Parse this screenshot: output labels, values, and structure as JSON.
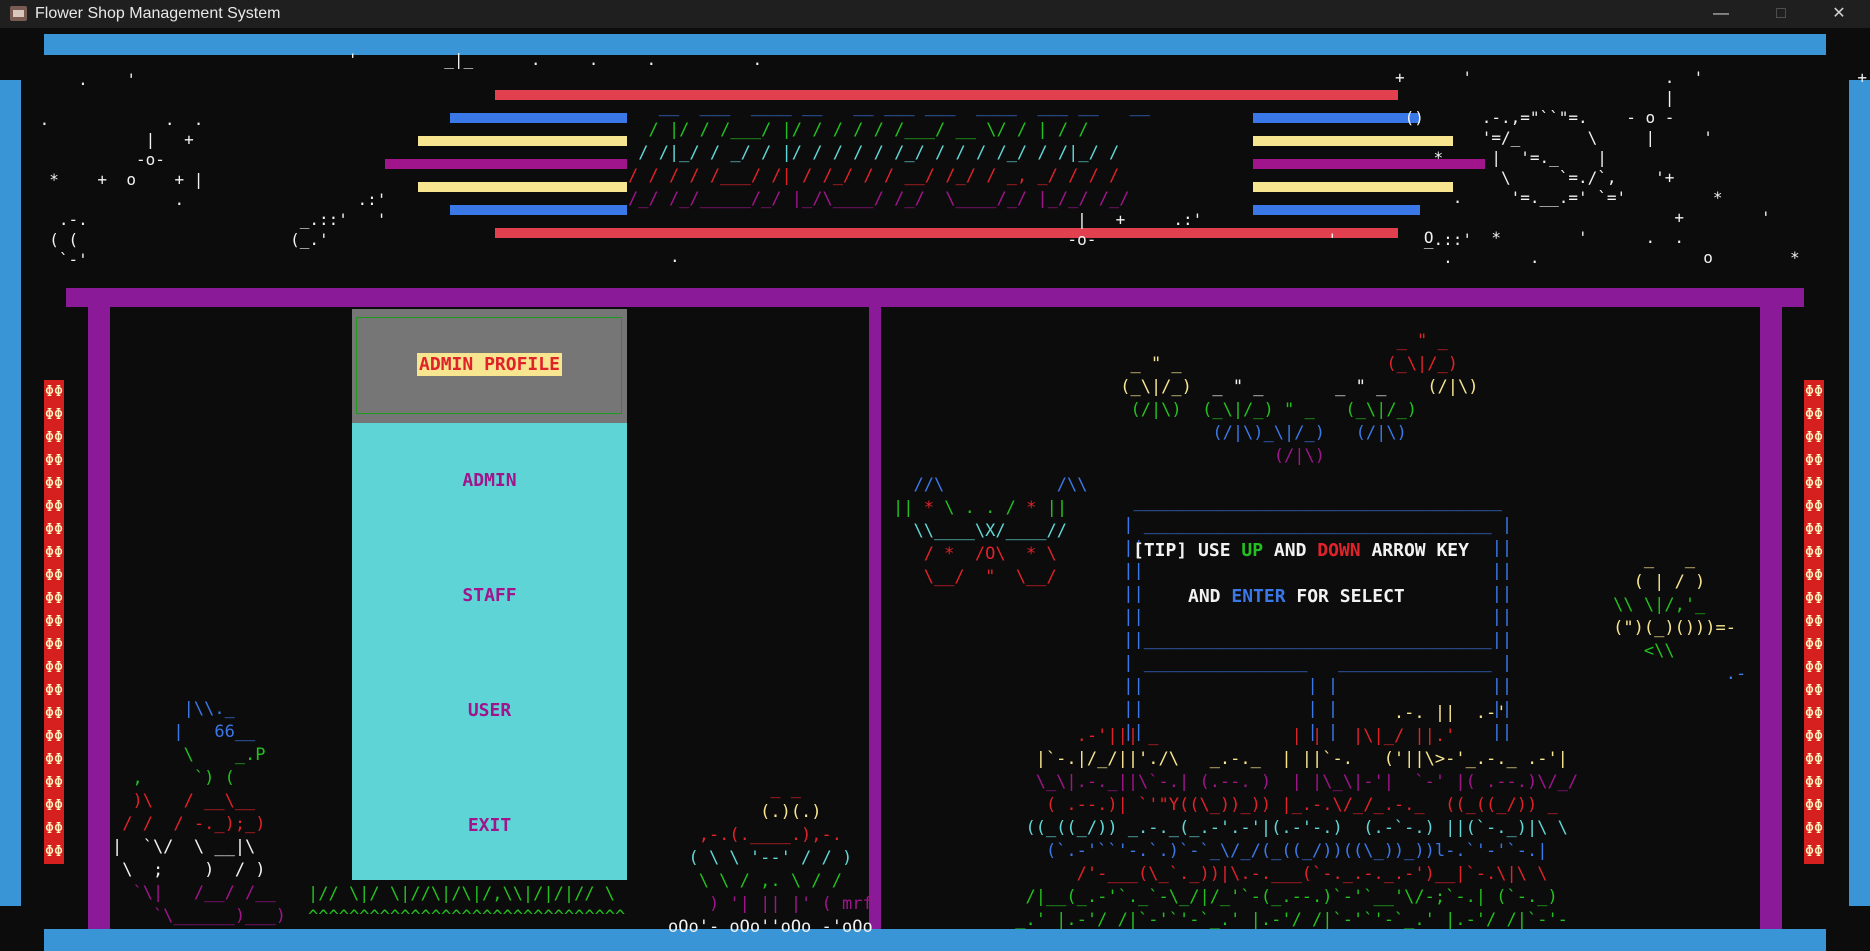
{
  "window": {
    "title": "Flower Shop Management System",
    "minimize": "—",
    "maximize": "□",
    "close": "✕"
  },
  "colors": {
    "blue_bar": "#3a95d7",
    "purple_frame": "#8b1a99",
    "menu_bg": "#5fd4d6",
    "menu_selected_bg": "#767676",
    "menu_text": "#a0148c"
  },
  "menu": {
    "items": [
      {
        "label": "ADMIN PROFILE",
        "selected": true
      },
      {
        "label": "ADMIN",
        "selected": false
      },
      {
        "label": "STAFF",
        "selected": false
      },
      {
        "label": "USER",
        "selected": false
      },
      {
        "label": "EXIT",
        "selected": false
      }
    ]
  },
  "tip": {
    "line1_prefix": "[TIP] USE ",
    "up": "UP",
    "and": " AND ",
    "down": "DOWN",
    "line1_suffix": " ARROW KEY",
    "line2_prefix": "AND ",
    "enter": "ENTER",
    "line2_suffix": " FOR SELECT"
  },
  "ascii": {
    "credit": "mrf",
    "ornament_glyph": "ΦΦ"
  }
}
